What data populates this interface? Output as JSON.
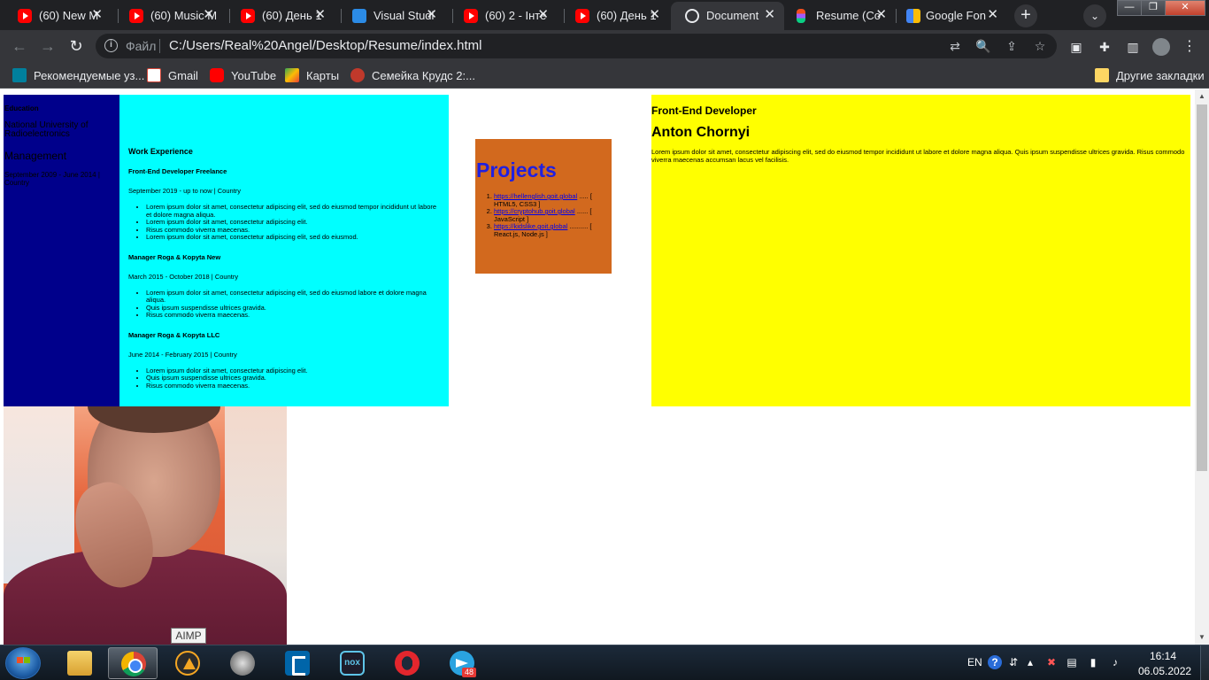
{
  "browser": {
    "tabs": [
      {
        "title": "(60) New M",
        "icon": "youtube-icon"
      },
      {
        "title": "(60) Music M",
        "icon": "youtube-icon"
      },
      {
        "title": "(60) День 1",
        "icon": "youtube-icon"
      },
      {
        "title": "Visual Studi",
        "icon": "vscode-icon"
      },
      {
        "title": "(60) 2 - Інте",
        "icon": "youtube-icon"
      },
      {
        "title": "(60) День 1",
        "icon": "youtube-icon"
      },
      {
        "title": "Document",
        "icon": "globe-icon"
      },
      {
        "title": "Resume (Co",
        "icon": "figma-icon"
      },
      {
        "title": "Google Fon",
        "icon": "google-fonts-icon"
      }
    ],
    "new_tab_label": "+",
    "tab_search_label": "⌄",
    "window_controls": {
      "minimize": "—",
      "maximize": "❐",
      "close": "✕"
    },
    "nav": {
      "back": "←",
      "forward": "→",
      "reload": "↻"
    },
    "omnibox": {
      "scheme_label": "Файл",
      "url": "C:/Users/Real%20Angel/Desktop/Resume/index.html",
      "info_glyph": "i"
    },
    "omnibox_icons": {
      "translate": "⇄",
      "zoom": "🔍",
      "share": "⇪",
      "star": "☆"
    },
    "toolbar_icons": {
      "ext1": "▣",
      "extensions": "✚",
      "sidepanel": "▥",
      "menu": "⋮"
    },
    "bookmarks": [
      {
        "label": "Рекомендуемые уз...",
        "icon": "bing-icon"
      },
      {
        "label": "Gmail",
        "icon": "gmail-icon"
      },
      {
        "label": "YouTube",
        "icon": "youtube-icon"
      },
      {
        "label": "Карты",
        "icon": "maps-icon"
      },
      {
        "label": "Семейка Крудс 2:...",
        "icon": "game-icon"
      }
    ],
    "other_bookmarks": "Другие закладки"
  },
  "page": {
    "education": {
      "heading": "Education",
      "university": "National University of Radioelectronics",
      "degree": "Management",
      "dates": "September 2009 - June 2014 | Country"
    },
    "work": {
      "heading": "Work Experience",
      "jobs": [
        {
          "title": "Front-End Developer Freelance",
          "dates": "September 2019 - up to now | Country",
          "bullets": [
            "Lorem ipsum dolor sit amet, consectetur adipiscing elit, sed do eiusmod tempor incididunt ut labore et dolore magna aliqua.",
            "Lorem ipsum dolor sit amet, consectetur adipiscing elit.",
            "Risus commodo viverra maecenas.",
            "Lorem ipsum dolor sit amet, consectetur adipiscing elit, sed do eiusmod."
          ]
        },
        {
          "title": "Manager Roga & Kopyta New",
          "dates": "March 2015 - October 2018 | Country",
          "bullets": [
            "Lorem ipsum dolor sit amet, consectetur adipiscing elit, sed do eiusmod labore et dolore magna aliqua.",
            "Quis ipsum suspendisse ultrices gravida.",
            "Risus commodo viverra maecenas."
          ]
        },
        {
          "title": "Manager Roga & Kopyta LLC",
          "dates": "June 2014 - February 2015 | Country",
          "bullets": [
            "Lorem ipsum dolor sit amet, consectetur adipiscing elit.",
            "Quis ipsum suspendisse ultrices gravida.",
            "Risus commodo viverra maecenas."
          ]
        }
      ]
    },
    "projects": {
      "heading": "Projects",
      "items": [
        {
          "link": "https://hellenglish.goit.global",
          "dots": " ..... [ ",
          "tech": "HTML5, CSS3 ]"
        },
        {
          "link": "https://cryptohub.goit.global",
          "dots": " ...... [ ",
          "tech": "JavaScript ]"
        },
        {
          "link": "https://kidslike.goit.global",
          "dots": " .......... [ ",
          "tech": "React.js, Node.js ]"
        }
      ]
    },
    "intro": {
      "role": "Front-End Developer",
      "name": "Anton Chornyi",
      "summary": "Lorem ipsum dolor sit amet, consectetur adipiscing elit, sed do eiusmod tempor incididunt ut labore et dolore magna aliqua. Quis ipsum suspendisse ultrices gravida. Risus commodo viverra maecenas accumsan lacus vel facilisis."
    },
    "photo_alt": "profile-photo"
  },
  "colors": {
    "education_bg": "#00008b",
    "work_bg": "#00ffff",
    "projects_bg": "#d2691e",
    "intro_bg": "#ffff00",
    "projects_title": "#2020e0"
  },
  "tooltip": {
    "label": "AIMP"
  },
  "taskbar": {
    "apps": [
      {
        "name": "windows-explorer",
        "active": false
      },
      {
        "name": "google-chrome",
        "active": true
      },
      {
        "name": "aimp",
        "active": false
      },
      {
        "name": "volume-mixer",
        "active": false
      },
      {
        "name": "visual-studio-code",
        "active": false
      },
      {
        "name": "nox-player",
        "active": false
      },
      {
        "name": "opera",
        "active": false
      },
      {
        "name": "telegram",
        "active": false
      }
    ],
    "telegram_badge": "48",
    "nox_label": "nox",
    "tray": {
      "language": "EN",
      "help": "?",
      "time": "16:14",
      "date": "06.05.2022"
    }
  }
}
